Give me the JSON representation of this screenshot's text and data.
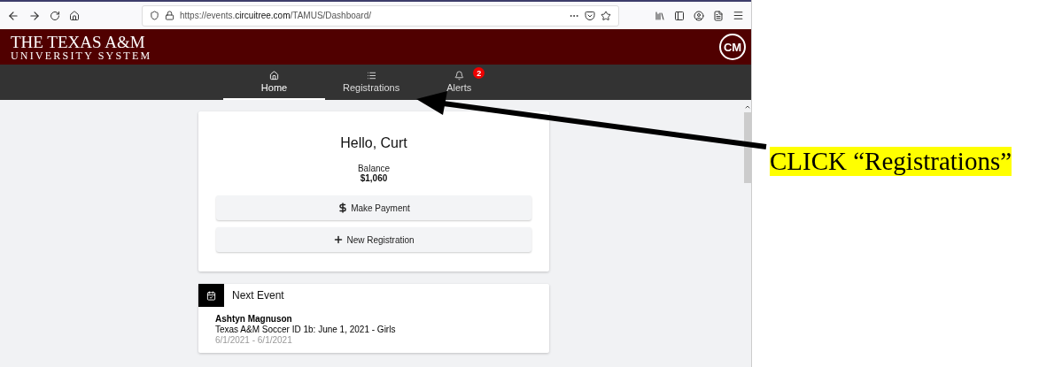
{
  "browser": {
    "url": "https://events.**circuitree.com**/TAMUS/Dashboard/"
  },
  "header": {
    "logo_line_1": "THE TEXAS A&M",
    "logo_line_2": "UNIVERSITY SYSTEM",
    "avatar": "CM"
  },
  "nav_tabs": [
    {
      "label": "Home",
      "kind": "home",
      "selected": true
    },
    {
      "label": "Registrations",
      "kind": "list",
      "selected": false
    },
    {
      "label": "Alerts",
      "kind": "alerts",
      "selected": false,
      "badge": "2"
    }
  ],
  "welcome_card": {
    "greeting": "Hello, Curt",
    "balance_label": "Balance",
    "balance": "$1,060",
    "buttons": [
      {
        "label": "Make Payment",
        "kind": "payment"
      },
      {
        "label": "New Registration",
        "kind": "add"
      }
    ]
  },
  "next_event": {
    "title": "Next Event",
    "attendee": "Ashtyn Magnuson",
    "event": "Texas A&M Soccer ID 1b: June 1, 2021 - Girls",
    "dates": "6/1/2021 - 6/1/2021"
  },
  "annotation": {
    "text": "CLICK “Registrations”"
  }
}
